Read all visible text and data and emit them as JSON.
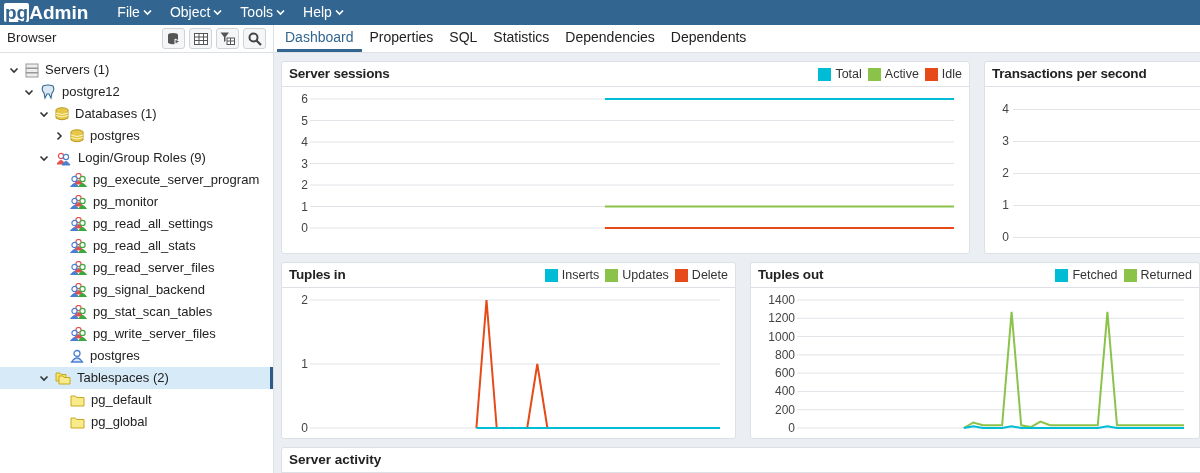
{
  "app": {
    "logo_prefix": "pg",
    "logo_suffix": "Admin"
  },
  "menu": [
    {
      "label": "File"
    },
    {
      "label": "Object"
    },
    {
      "label": "Tools"
    },
    {
      "label": "Help"
    }
  ],
  "browser": {
    "title": "Browser",
    "tree": [
      {
        "label": "Servers (1)",
        "kind": "server-group",
        "expanded": true,
        "selected": false,
        "children": [
          {
            "label": "postgre12",
            "kind": "server",
            "expanded": true,
            "selected": false,
            "children": [
              {
                "label": "Databases (1)",
                "kind": "database-group",
                "expanded": true,
                "selected": false,
                "children": [
                  {
                    "label": "postgres",
                    "kind": "database",
                    "expanded": false,
                    "selected": false
                  }
                ]
              },
              {
                "label": "Login/Group Roles (9)",
                "kind": "role-group",
                "expanded": true,
                "selected": false,
                "children": [
                  {
                    "label": "pg_execute_server_program",
                    "kind": "role",
                    "selected": false
                  },
                  {
                    "label": "pg_monitor",
                    "kind": "role",
                    "selected": false
                  },
                  {
                    "label": "pg_read_all_settings",
                    "kind": "role",
                    "selected": false
                  },
                  {
                    "label": "pg_read_all_stats",
                    "kind": "role",
                    "selected": false
                  },
                  {
                    "label": "pg_read_server_files",
                    "kind": "role",
                    "selected": false
                  },
                  {
                    "label": "pg_signal_backend",
                    "kind": "role",
                    "selected": false
                  },
                  {
                    "label": "pg_stat_scan_tables",
                    "kind": "role",
                    "selected": false
                  },
                  {
                    "label": "pg_write_server_files",
                    "kind": "role",
                    "selected": false
                  },
                  {
                    "label": "postgres",
                    "kind": "user",
                    "selected": false
                  }
                ]
              },
              {
                "label": "Tablespaces (2)",
                "kind": "tablespace-group",
                "expanded": true,
                "selected": true,
                "children": [
                  {
                    "label": "pg_default",
                    "kind": "tablespace",
                    "selected": false
                  },
                  {
                    "label": "pg_global",
                    "kind": "tablespace",
                    "selected": false
                  }
                ]
              }
            ]
          }
        ]
      }
    ]
  },
  "tabs": [
    {
      "label": "Dashboard",
      "selected": true
    },
    {
      "label": "Properties",
      "selected": false
    },
    {
      "label": "SQL",
      "selected": false
    },
    {
      "label": "Statistics",
      "selected": false
    },
    {
      "label": "Dependencies",
      "selected": false
    },
    {
      "label": "Dependents",
      "selected": false
    }
  ],
  "panels": {
    "server_sessions": {
      "title": "Server sessions",
      "chart_data": {
        "type": "line",
        "grid": true,
        "categories": [
          null,
          null,
          null,
          null,
          null,
          null,
          null,
          null,
          null,
          null,
          null,
          null,
          null,
          null,
          null,
          null,
          null,
          null,
          null,
          null,
          null,
          null,
          null
        ],
        "ylim": [
          0,
          6
        ],
        "yticks": [
          0,
          1,
          2,
          3,
          4,
          5,
          6
        ],
        "series": [
          {
            "name": "Total",
            "color": "#00bcd4",
            "values": [
              null,
              null,
              null,
              null,
              null,
              null,
              null,
              null,
              null,
              null,
              6,
              6,
              6,
              6,
              6,
              6,
              6,
              6,
              6,
              6,
              6,
              6,
              6
            ]
          },
          {
            "name": "Active",
            "color": "#8bc34a",
            "values": [
              null,
              null,
              null,
              null,
              null,
              null,
              null,
              null,
              null,
              null,
              1,
              1,
              1,
              1,
              1,
              1,
              1,
              1,
              1,
              1,
              1,
              1,
              1
            ]
          },
          {
            "name": "Idle",
            "color": "#e64a19",
            "values": [
              null,
              null,
              null,
              null,
              null,
              null,
              null,
              null,
              null,
              null,
              0,
              0,
              0,
              0,
              0,
              0,
              0,
              0,
              0,
              0,
              0,
              0,
              0
            ]
          }
        ]
      }
    },
    "transactions": {
      "title": "Transactions per second",
      "axis_labels": [
        "4",
        "3",
        "2",
        "1",
        "0"
      ]
    },
    "tuples_in": {
      "title": "Tuples in",
      "chart_data": {
        "type": "line",
        "grid": true,
        "categories": [
          null,
          null,
          null,
          null,
          null,
          null,
          null,
          null,
          null,
          null,
          null,
          null,
          null,
          null,
          null,
          null,
          null,
          null,
          null,
          null,
          null,
          null,
          null,
          null,
          null,
          null,
          null,
          null,
          null,
          null,
          null,
          null,
          null,
          null,
          null,
          null,
          null,
          null,
          null,
          null,
          null
        ],
        "ylim": [
          0,
          2
        ],
        "yticks": [
          0,
          1,
          2
        ],
        "series": [
          {
            "name": "Inserts",
            "color": "#00bcd4",
            "values": [
              null,
              null,
              null,
              null,
              null,
              null,
              null,
              null,
              null,
              null,
              null,
              null,
              null,
              null,
              null,
              null,
              0,
              0,
              0,
              0,
              0,
              0,
              0,
              0,
              0,
              0,
              0,
              0,
              0,
              0,
              0,
              0,
              0,
              0,
              0,
              0,
              0,
              0,
              0,
              0,
              0
            ]
          },
          {
            "name": "Updates",
            "color": "#8bc34a",
            "values": [
              null,
              null,
              null,
              null,
              null,
              null,
              null,
              null,
              null,
              null,
              null,
              null,
              null,
              null,
              null,
              null,
              null,
              null,
              null,
              null,
              null,
              null,
              null,
              null,
              null,
              null,
              null,
              null,
              null,
              null,
              null,
              null,
              null,
              null,
              null,
              null,
              null,
              null,
              null,
              null,
              null
            ]
          },
          {
            "name": "Delete",
            "color": "#e64a19",
            "values": [
              null,
              null,
              null,
              null,
              null,
              null,
              null,
              null,
              null,
              null,
              null,
              null,
              null,
              null,
              null,
              null,
              0,
              2,
              0,
              null,
              null,
              0,
              1,
              0,
              null,
              null,
              null,
              null,
              null,
              null,
              null,
              null,
              null,
              null,
              null,
              null,
              null,
              null,
              null,
              null,
              null
            ]
          }
        ]
      }
    },
    "tuples_out": {
      "title": "Tuples out",
      "chart_data": {
        "type": "line",
        "grid": true,
        "categories": [
          null,
          null,
          null,
          null,
          null,
          null,
          null,
          null,
          null,
          null,
          null,
          null,
          null,
          null,
          null,
          null,
          null,
          null,
          null,
          null,
          null,
          null,
          null,
          null,
          null,
          null,
          null,
          null,
          null,
          null,
          null,
          null,
          null,
          null,
          null,
          null,
          null,
          null,
          null,
          null,
          null
        ],
        "ylim": [
          0,
          1400
        ],
        "yticks": [
          0,
          200,
          400,
          600,
          800,
          1000,
          1200,
          1400
        ],
        "series": [
          {
            "name": "Fetched",
            "color": "#00bcd4",
            "values": [
              null,
              null,
              null,
              null,
              null,
              null,
              null,
              null,
              null,
              null,
              null,
              null,
              null,
              null,
              null,
              null,
              null,
              0,
              20,
              0,
              0,
              0,
              20,
              0,
              0,
              0,
              0,
              0,
              0,
              0,
              0,
              0,
              20,
              0,
              0,
              0,
              0,
              0,
              0,
              0,
              0
            ]
          },
          {
            "name": "Returned",
            "color": "#8bc34a",
            "values": [
              null,
              null,
              null,
              null,
              null,
              null,
              null,
              null,
              null,
              null,
              null,
              null,
              null,
              null,
              null,
              null,
              null,
              0,
              60,
              30,
              30,
              30,
              1270,
              30,
              10,
              70,
              30,
              30,
              30,
              30,
              30,
              30,
              1270,
              30,
              30,
              30,
              30,
              30,
              30,
              30,
              30
            ]
          }
        ]
      }
    },
    "server_activity": {
      "title": "Server activity"
    }
  }
}
